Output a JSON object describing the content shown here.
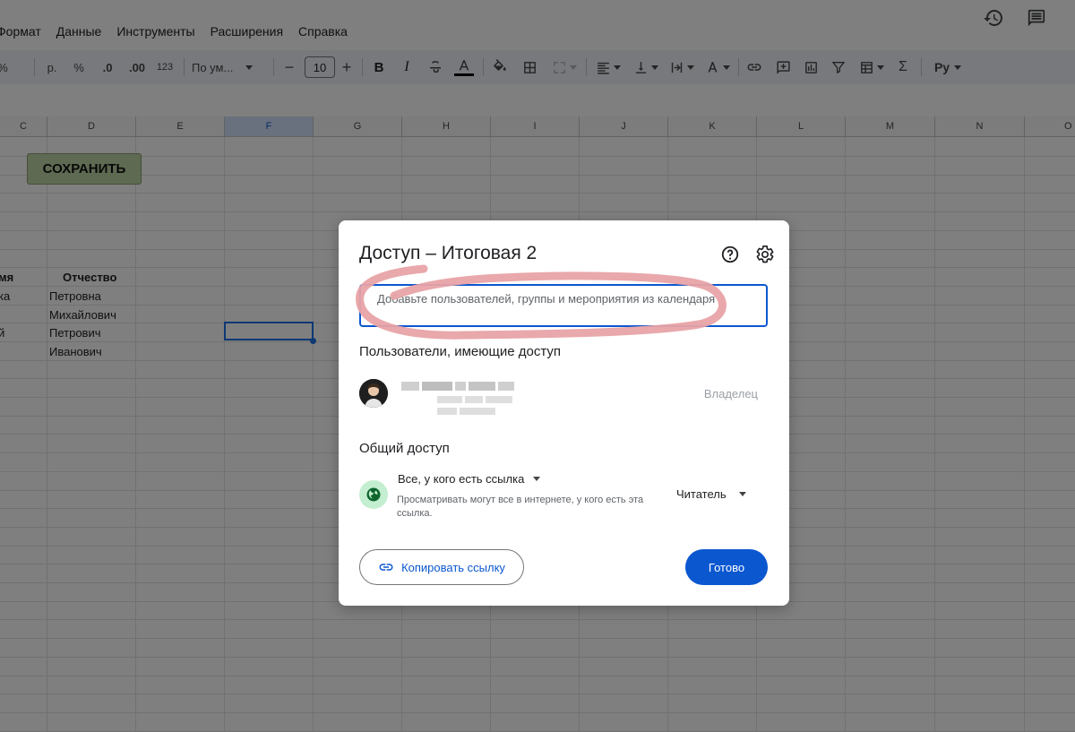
{
  "menu": {
    "items": [
      "Формат",
      "Данные",
      "Инструменты",
      "Расширения",
      "Справка"
    ]
  },
  "header_icons": [
    "history-icon",
    "comment-icon"
  ],
  "toolbar": {
    "currency_label": "р.",
    "percent_label": "%",
    "decrease_decimal_label": ".0",
    "increase_decimal_label": ".00",
    "number_format_label": "123",
    "font_family_label": "По ум...",
    "font_size": "10",
    "minus_label": "−",
    "plus_label": "+",
    "bold_label": "B",
    "italic_label": "I",
    "input_tools_label": "Рy"
  },
  "sheet": {
    "columns": [
      "C",
      "D",
      "E",
      "F",
      "G",
      "H",
      "I",
      "J",
      "K",
      "L",
      "M",
      "N",
      "O"
    ],
    "selected_column": "F",
    "save_button_label": "СОХРАНИТЬ",
    "header_row": [
      "мя",
      "Отчество"
    ],
    "rows": [
      [
        "ка",
        "Петровна"
      ],
      [
        "",
        "Михайлович"
      ],
      [
        "й",
        "Петрович"
      ],
      [
        "",
        "Иванович"
      ]
    ]
  },
  "dialog": {
    "title": "Доступ – Итоговая 2",
    "add_placeholder": "Добавьте пользователей, группы и мероприятия из календаря",
    "users_section_label": "Пользователи, имеющие доступ",
    "owner_role": "Владелец",
    "general_access_label": "Общий доступ",
    "access_option": "Все, у кого есть ссылка",
    "access_description": "Просматривать могут все в интернете, у кого есть эта ссылка.",
    "role": "Читатель",
    "copy_link_label": "Копировать ссылку",
    "done_label": "Готово"
  },
  "colors": {
    "primary": "#0b57d0",
    "annotation": "#e8a3a6",
    "globe_bg": "#c4eed0",
    "save_button_bg": "#bcd4a4"
  }
}
